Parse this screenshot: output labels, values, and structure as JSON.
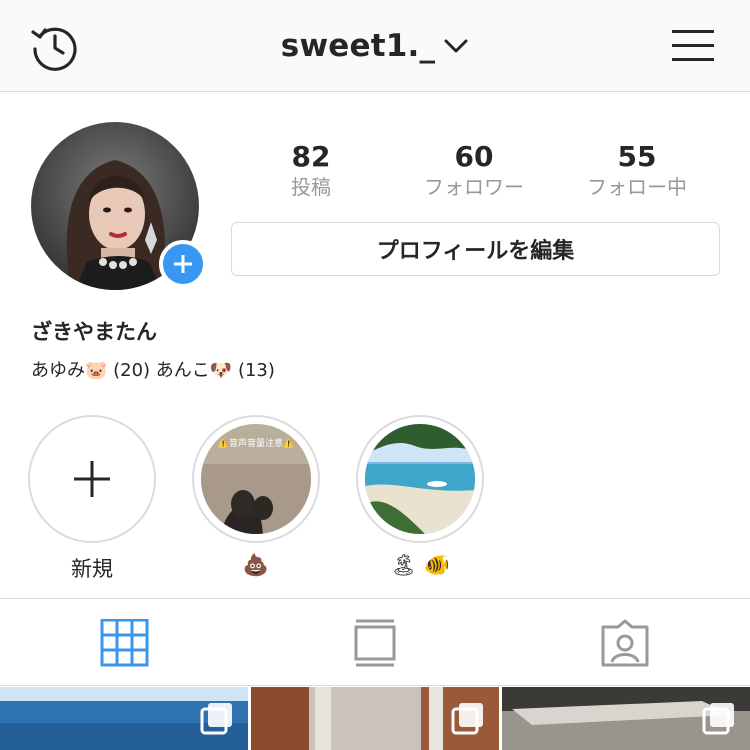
{
  "header": {
    "username": "sweet1._",
    "history_icon": "history-icon",
    "menu_icon": "hamburger-menu-icon",
    "chevron_icon": "chevron-down-icon"
  },
  "profile": {
    "display_name": "ざきやまたん",
    "bio": "あゆみ🐷 (20) あんこ🐶 (13)",
    "edit_button_label": "プロフィールを編集",
    "add_badge_icon": "plus-icon"
  },
  "stats": [
    {
      "value": "82",
      "label": "投稿"
    },
    {
      "value": "60",
      "label": "フォロワー"
    },
    {
      "value": "55",
      "label": "フォロー中"
    }
  ],
  "highlights": [
    {
      "label": "新規",
      "overlay_text": ""
    },
    {
      "label": "💩",
      "overlay_text": "⚠️音声音量注意⚠️"
    },
    {
      "label": "🏝 🐠",
      "overlay_text": ""
    }
  ],
  "tabs": [
    {
      "name": "grid",
      "icon": "grid-icon",
      "active": true
    },
    {
      "name": "feed",
      "icon": "list-icon",
      "active": false
    },
    {
      "name": "tagged",
      "icon": "tagged-person-icon",
      "active": false
    }
  ],
  "colors": {
    "accent": "#3897f0",
    "border": "#dbdbdb",
    "muted": "#999999",
    "text": "#262626"
  }
}
